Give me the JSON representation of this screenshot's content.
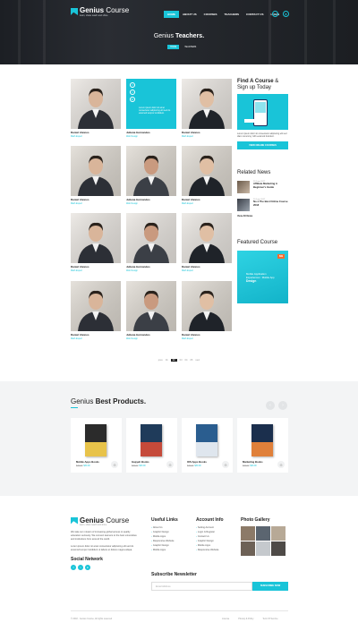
{
  "header": {
    "logo_bold": "Genius",
    "logo_light": " Course",
    "tagline": "learn, share teach and shine",
    "nav": [
      "HOME",
      "ABOUT US",
      "COURSES",
      "TEACHERS",
      "CONTACT US",
      "LOGIN"
    ],
    "active_nav": 0,
    "icons": [
      "search-icon",
      "user-icon"
    ],
    "page_title_light": "Genius ",
    "page_title_bold": "Teachers.",
    "breadcrumb": [
      "HOME",
      "TEACHERS"
    ]
  },
  "teachers": [
    {
      "name": "Daniel Alvares",
      "role": "Math Expert"
    },
    {
      "name": "Juliana Hernandes",
      "role": "Web Design"
    },
    {
      "name": "Daniel Alvares",
      "role": "Math Expert"
    },
    {
      "name": "Daniel Alvares",
      "role": "Math Expert"
    },
    {
      "name": "Juliana Hernandes",
      "role": "Web Design"
    },
    {
      "name": "Daniel Alvares",
      "role": "Math Expert"
    },
    {
      "name": "Daniel Alvares",
      "role": "Math Expert"
    },
    {
      "name": "Juliana Hernandes",
      "role": "Web Design"
    },
    {
      "name": "Daniel Alvares",
      "role": "Math Expert"
    },
    {
      "name": "Daniel Alvares",
      "role": "Math Expert"
    },
    {
      "name": "Juliana Hernandes",
      "role": "Web Design"
    },
    {
      "name": "Daniel Alvares",
      "role": "Math Expert"
    }
  ],
  "featured_teacher_text": "Lorem ipsum dolor sit amet consectetur adipiscing elit sed do eiusmod tempor incididunt.",
  "sidebar": {
    "find_bold": "Find A Course",
    "find_amp": " &",
    "find_line2": "Sign up Today",
    "find_text": "Lorem ipsum dolor sit consectetur adipiscing elit sed diam nonummy nibh euismod tincidunt.",
    "find_button": "VIEW ONLINE COURSES",
    "news_bold": "Related",
    "news_light": " News",
    "news": [
      {
        "date": "20 June 2017",
        "title": "Affiliate Marketing A Beginner's Guide"
      },
      {
        "date": "20 June 2017",
        "title": "No.1 The Best Online Course 2018"
      }
    ],
    "view_all": "View All News",
    "featured_bold": "Featured",
    "featured_light": " Course",
    "promo_price": "$99",
    "promo_text1": "Mobile Application",
    "promo_text2": "Experiences : Mobile App",
    "promo_text3": "Design"
  },
  "pagination": [
    "prev",
    "01",
    "02",
    "03",
    "04",
    "05",
    "next"
  ],
  "pagination_active": 2,
  "products": {
    "title_light": "Genius ",
    "title_bold": "Best Products.",
    "items": [
      {
        "name": "Mobile Apps Books",
        "old": "$40.00",
        "price": "$30.00"
      },
      {
        "name": "Gapyeh Books",
        "old": "$40.00",
        "price": "$30.00"
      },
      {
        "name": "IOS Apps Books",
        "old": "$40.00",
        "price": "$30.00"
      },
      {
        "name": "Marketing Books",
        "old": "$40.00",
        "price": "$30.00"
      }
    ]
  },
  "footer": {
    "about1": "We take our mission of increasing global access to quality education seriously. We connect learners to the best universities and institutions from around the world.",
    "about2": "Lorem ipsum dolor sit amet consectetur adipiscing elit sed do eiusmod tempor incididunt ut labore et dolore magna aliqua.",
    "social_title": "Social Network",
    "social": [
      "f",
      "t",
      "in"
    ],
    "useful_title": "Useful Links",
    "useful": [
      "About Us",
      "Graphic Design",
      "Mobile Apps",
      "Responsive Website",
      "Graphic Design",
      "Mobile Apps"
    ],
    "account_title": "Account Info",
    "account": [
      "Setting Account",
      "Login & Register",
      "Contact Us",
      "Graphic Design",
      "Mobile Apps",
      "Responsive Website"
    ],
    "gallery_title": "Photo Gallery",
    "newsletter_title": "Subscribe Newsletter",
    "newsletter_placeholder": "Email Address",
    "newsletter_button": "SUBSCRIBE NOW",
    "copyright": "© 2018 - Genius Course, All rights reserved",
    "links": [
      "License",
      "Privacy & Policy",
      "Term Of Service"
    ]
  }
}
